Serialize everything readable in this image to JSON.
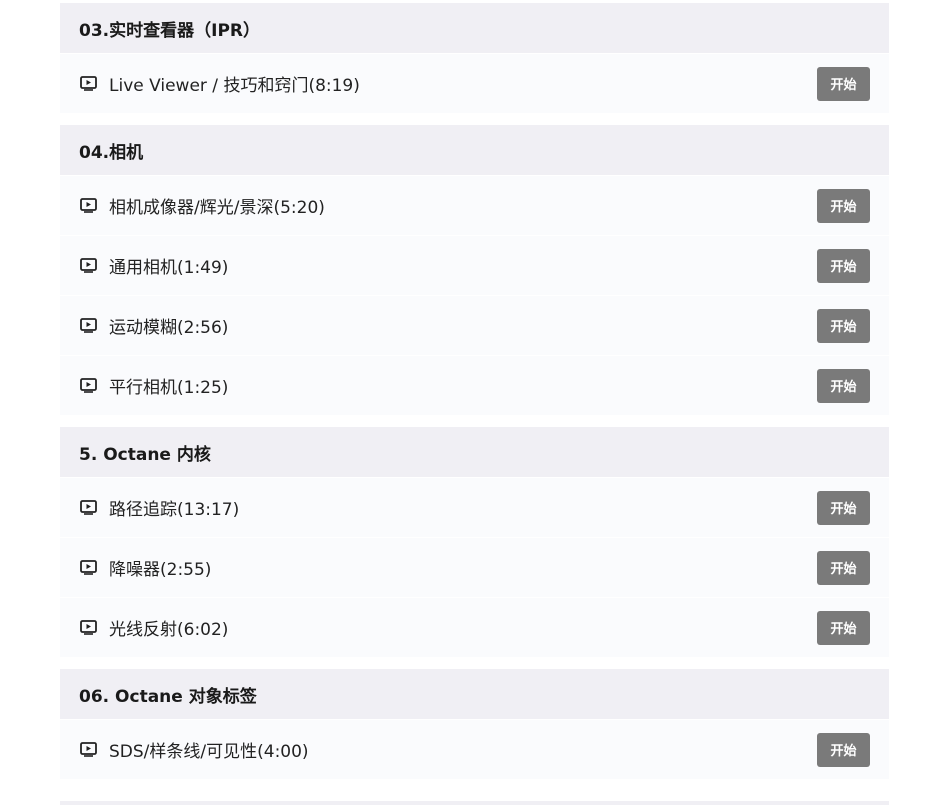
{
  "sections": [
    {
      "title": "03.实时查看器（IPR）",
      "lessons": [
        {
          "title": "Live Viewer / 技巧和窍门(8:19)",
          "button": "开始"
        }
      ]
    },
    {
      "title": "04.相机",
      "lessons": [
        {
          "title": "相机成像器/辉光/景深(5:20)",
          "button": "开始"
        },
        {
          "title": "通用相机(1:49)",
          "button": "开始"
        },
        {
          "title": "运动模糊(2:56)",
          "button": "开始"
        },
        {
          "title": "平行相机(1:25)",
          "button": "开始"
        }
      ]
    },
    {
      "title": "5. Octane 内核",
      "lessons": [
        {
          "title": "路径追踪(13:17)",
          "button": "开始"
        },
        {
          "title": "降噪器(2:55)",
          "button": "开始"
        },
        {
          "title": "光线反射(6:02)",
          "button": "开始"
        }
      ]
    },
    {
      "title": "06. Octane 对象标签",
      "lessons": [
        {
          "title": "SDS/样条线/可见性(4:00)",
          "button": "开始"
        }
      ]
    }
  ],
  "icons": {
    "lesson_icon": "play-video-icon"
  },
  "colors": {
    "section_header_bg": "#f0eff4",
    "lesson_bg": "#fafbfd",
    "button_bg": "#7a7a7a",
    "button_text": "#ffffff"
  }
}
